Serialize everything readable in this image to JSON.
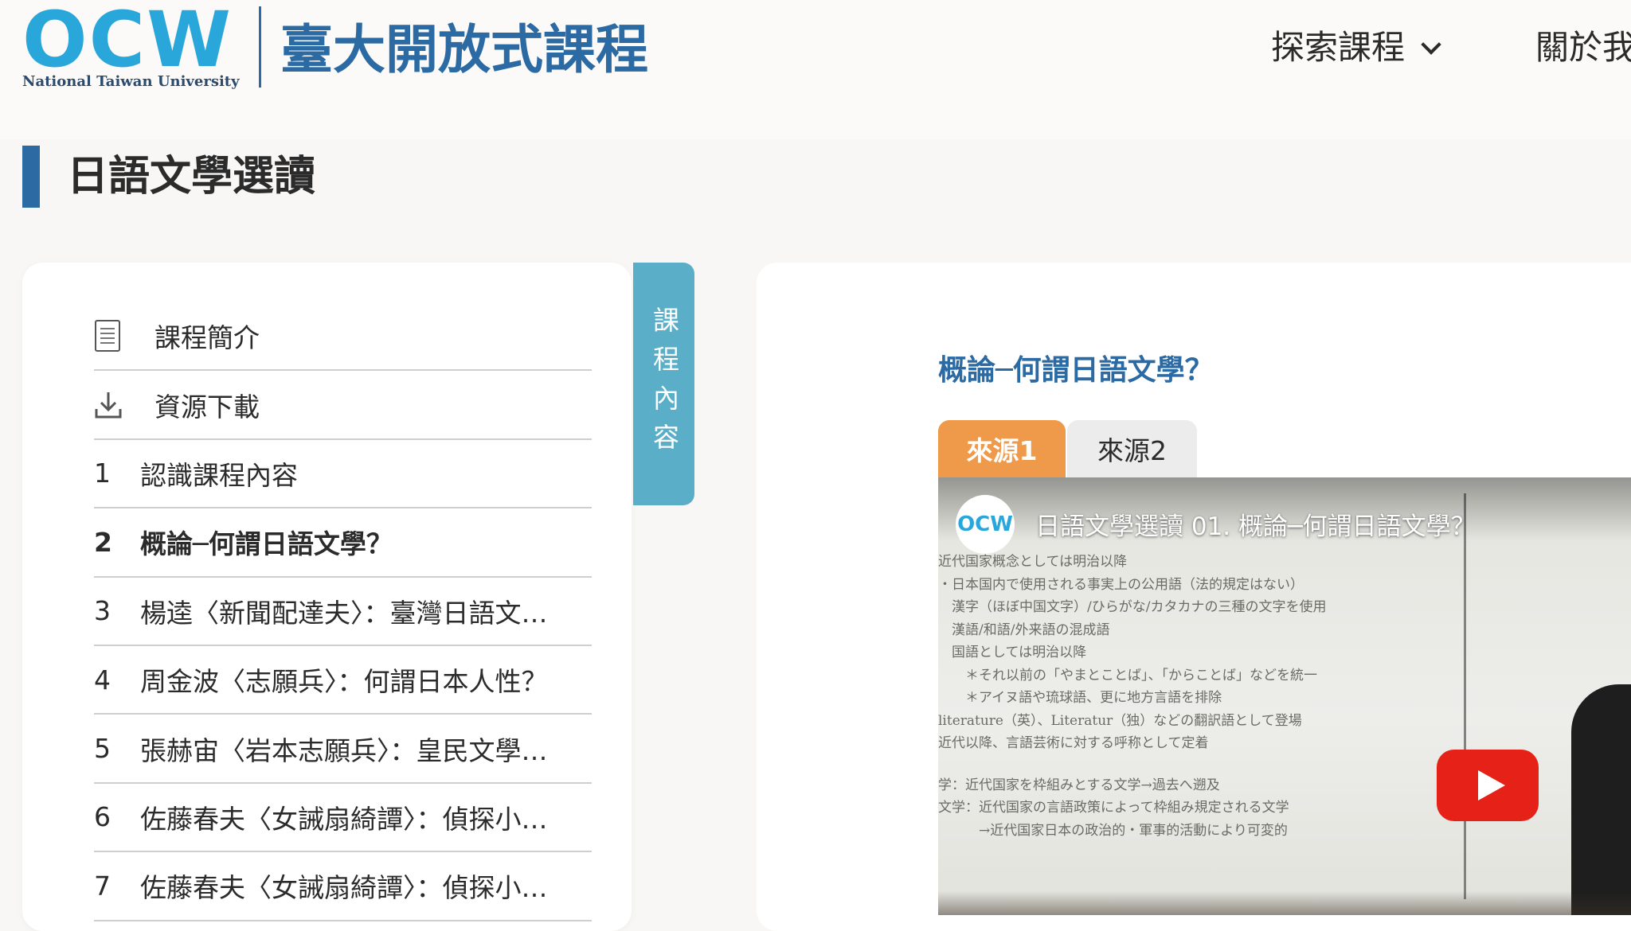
{
  "header": {
    "logo_mark": "OCW",
    "logo_sub": "National Taiwan University",
    "site_title": "臺大開放式課程",
    "nav_explore": "探索課程",
    "nav_about": "關於我"
  },
  "page": {
    "title": "日語文學選讀"
  },
  "sidebar": {
    "vertical_tab": "課程內容",
    "items": [
      {
        "icon": "document-icon",
        "label": "課程簡介"
      },
      {
        "icon": "download-icon",
        "label": "資源下載"
      },
      {
        "num": "1",
        "label": "認識課程內容"
      },
      {
        "num": "2",
        "label": "概論─何謂日語文學？",
        "active": true
      },
      {
        "num": "3",
        "label": "楊逵〈新聞配達夫〉：臺灣日語文…"
      },
      {
        "num": "4",
        "label": "周金波〈志願兵〉：何謂日本人性？"
      },
      {
        "num": "5",
        "label": "張赫宙〈岩本志願兵〉：皇民文學…"
      },
      {
        "num": "6",
        "label": "佐藤春夫〈女誡扇綺譚〉：偵探小…"
      },
      {
        "num": "7",
        "label": "佐藤春夫〈女誡扇綺譚〉：偵探小…"
      }
    ]
  },
  "main": {
    "lesson_title": "概論─何謂日語文學？",
    "tabs": [
      {
        "label": "來源1",
        "active": true
      },
      {
        "label": "來源2"
      }
    ],
    "video": {
      "channel_mark": "OCW",
      "title": "日語文學選讀 01. 概論─何謂日語文學？",
      "slide_lines": [
        "近代国家概念としては明治以降",
        "・日本国内で使用される事実上の公用語（法的規定はない）",
        "　漢字（ほぼ中国文字）/ひらがな/カタカナの三種の文字を使用",
        "　漢語/和語/外来語の混成語",
        "　国語としては明治以降",
        "　　＊それ以前の「やまとことば」、「からことば」などを統一",
        "　　＊アイヌ語や琉球語、更に地方言語を排除",
        "literature（英）、Literatur（独）などの翻訳語として登場",
        "近代以降、言語芸術に対する呼称として定着",
        "学：近代国家を枠組みとする文学→過去へ遡及",
        "文学：近代国家の言語政策によって枠組み規定される文学",
        "　　　→近代国家日本の政治的・軍事的活動により可変的"
      ]
    }
  },
  "colors": {
    "brand_blue": "#2b6aa3",
    "logo_cyan": "#2aa7da",
    "tab_teal": "#5aaec8",
    "source_orange": "#ee9a4a",
    "youtube_red": "#e62117"
  }
}
